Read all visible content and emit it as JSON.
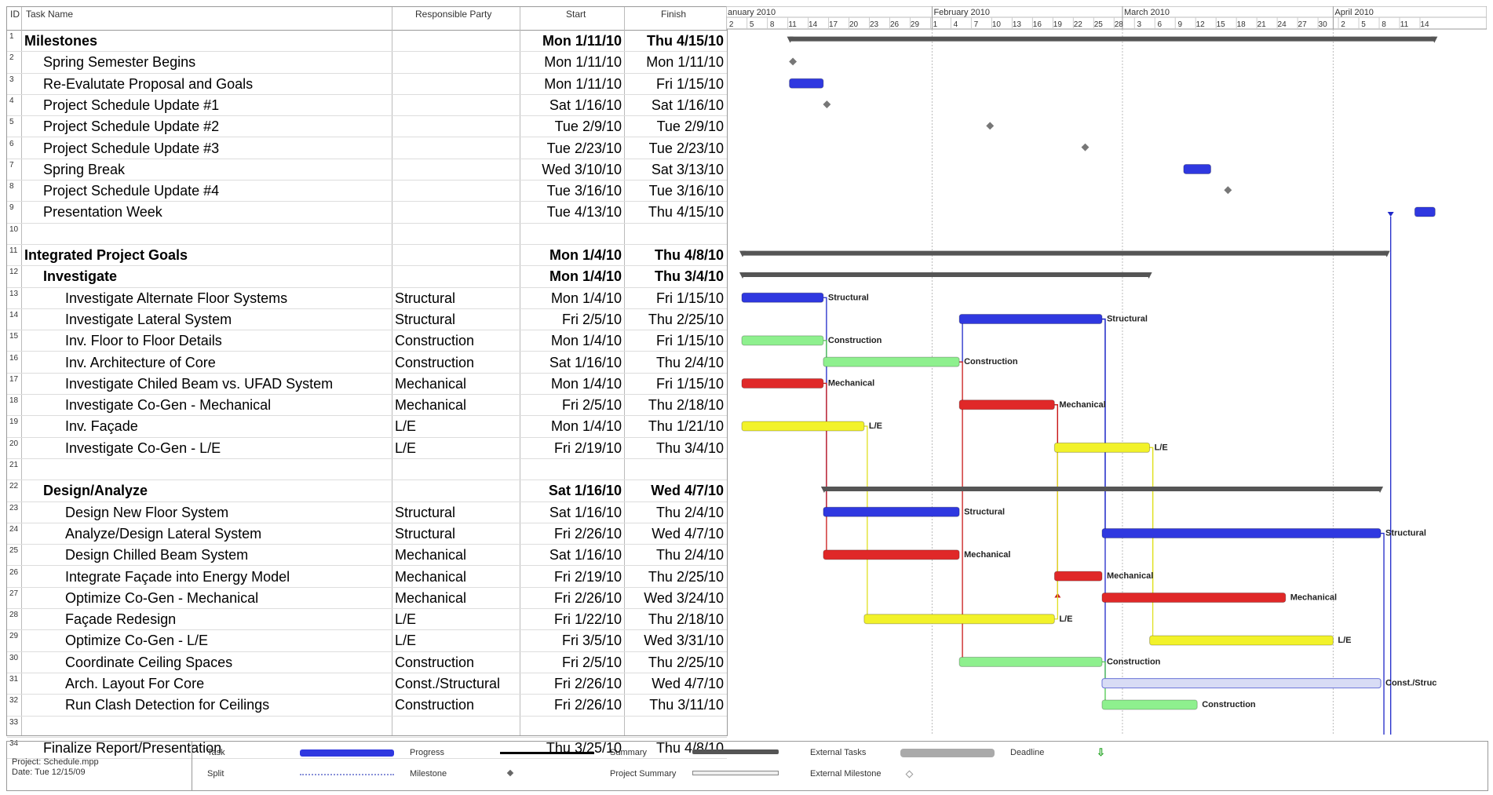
{
  "table": {
    "headers": {
      "id": "ID",
      "name": "Task Name",
      "party": "Responsible Party",
      "start": "Start",
      "finish": "Finish"
    },
    "rows": [
      {
        "id": "1",
        "name": "Milestones",
        "party": "",
        "start": "Mon 1/11/10",
        "finish": "Thu 4/15/10",
        "level": 0,
        "bold": true
      },
      {
        "id": "2",
        "name": "Spring Semester Begins",
        "party": "",
        "start": "Mon 1/11/10",
        "finish": "Mon 1/11/10",
        "level": 1,
        "bold": false
      },
      {
        "id": "3",
        "name": "Re-Evalutate Proposal and Goals",
        "party": "",
        "start": "Mon 1/11/10",
        "finish": "Fri 1/15/10",
        "level": 1,
        "bold": false
      },
      {
        "id": "4",
        "name": "Project Schedule Update #1",
        "party": "",
        "start": "Sat 1/16/10",
        "finish": "Sat 1/16/10",
        "level": 1,
        "bold": false
      },
      {
        "id": "5",
        "name": "Project Schedule Update #2",
        "party": "",
        "start": "Tue 2/9/10",
        "finish": "Tue 2/9/10",
        "level": 1,
        "bold": false
      },
      {
        "id": "6",
        "name": "Project Schedule Update #3",
        "party": "",
        "start": "Tue 2/23/10",
        "finish": "Tue 2/23/10",
        "level": 1,
        "bold": false
      },
      {
        "id": "7",
        "name": "Spring Break",
        "party": "",
        "start": "Wed 3/10/10",
        "finish": "Sat 3/13/10",
        "level": 1,
        "bold": false
      },
      {
        "id": "8",
        "name": "Project Schedule Update #4",
        "party": "",
        "start": "Tue 3/16/10",
        "finish": "Tue 3/16/10",
        "level": 1,
        "bold": false
      },
      {
        "id": "9",
        "name": "Presentation Week",
        "party": "",
        "start": "Tue 4/13/10",
        "finish": "Thu 4/15/10",
        "level": 1,
        "bold": false
      },
      {
        "id": "10",
        "name": "",
        "party": "",
        "start": "",
        "finish": "",
        "level": 0,
        "bold": false
      },
      {
        "id": "11",
        "name": "Integrated Project Goals",
        "party": "",
        "start": "Mon 1/4/10",
        "finish": "Thu 4/8/10",
        "level": 0,
        "bold": true
      },
      {
        "id": "12",
        "name": "Investigate",
        "party": "",
        "start": "Mon 1/4/10",
        "finish": "Thu 3/4/10",
        "level": 1,
        "bold": true
      },
      {
        "id": "13",
        "name": "Investigate Alternate Floor Systems",
        "party": "Structural",
        "start": "Mon 1/4/10",
        "finish": "Fri 1/15/10",
        "level": 2,
        "bold": false
      },
      {
        "id": "14",
        "name": "Investigate Lateral System",
        "party": "Structural",
        "start": "Fri 2/5/10",
        "finish": "Thu 2/25/10",
        "level": 2,
        "bold": false
      },
      {
        "id": "15",
        "name": "Inv. Floor to Floor Details",
        "party": "Construction",
        "start": "Mon 1/4/10",
        "finish": "Fri 1/15/10",
        "level": 2,
        "bold": false
      },
      {
        "id": "16",
        "name": "Inv. Architecture of Core",
        "party": "Construction",
        "start": "Sat 1/16/10",
        "finish": "Thu 2/4/10",
        "level": 2,
        "bold": false
      },
      {
        "id": "17",
        "name": "Investigate Chiled Beam vs. UFAD System",
        "party": "Mechanical",
        "start": "Mon 1/4/10",
        "finish": "Fri 1/15/10",
        "level": 2,
        "bold": false
      },
      {
        "id": "18",
        "name": "Investigate Co-Gen - Mechanical",
        "party": "Mechanical",
        "start": "Fri 2/5/10",
        "finish": "Thu 2/18/10",
        "level": 2,
        "bold": false
      },
      {
        "id": "19",
        "name": "Inv. Façade",
        "party": "L/E",
        "start": "Mon 1/4/10",
        "finish": "Thu 1/21/10",
        "level": 2,
        "bold": false
      },
      {
        "id": "20",
        "name": "Investigate Co-Gen - L/E",
        "party": "L/E",
        "start": "Fri 2/19/10",
        "finish": "Thu 3/4/10",
        "level": 2,
        "bold": false
      },
      {
        "id": "21",
        "name": "",
        "party": "",
        "start": "",
        "finish": "",
        "level": 0,
        "bold": false
      },
      {
        "id": "22",
        "name": "Design/Analyze",
        "party": "",
        "start": "Sat 1/16/10",
        "finish": "Wed 4/7/10",
        "level": 1,
        "bold": true
      },
      {
        "id": "23",
        "name": "Design New Floor System",
        "party": "Structural",
        "start": "Sat 1/16/10",
        "finish": "Thu 2/4/10",
        "level": 2,
        "bold": false
      },
      {
        "id": "24",
        "name": "Analyze/Design Lateral System",
        "party": "Structural",
        "start": "Fri 2/26/10",
        "finish": "Wed 4/7/10",
        "level": 2,
        "bold": false
      },
      {
        "id": "25",
        "name": "Design Chilled Beam System",
        "party": "Mechanical",
        "start": "Sat 1/16/10",
        "finish": "Thu 2/4/10",
        "level": 2,
        "bold": false
      },
      {
        "id": "26",
        "name": "Integrate Façade into Energy Model",
        "party": "Mechanical",
        "start": "Fri 2/19/10",
        "finish": "Thu 2/25/10",
        "level": 2,
        "bold": false
      },
      {
        "id": "27",
        "name": "Optimize Co-Gen - Mechanical",
        "party": "Mechanical",
        "start": "Fri 2/26/10",
        "finish": "Wed 3/24/10",
        "level": 2,
        "bold": false
      },
      {
        "id": "28",
        "name": "Façade Redesign",
        "party": "L/E",
        "start": "Fri 1/22/10",
        "finish": "Thu 2/18/10",
        "level": 2,
        "bold": false
      },
      {
        "id": "29",
        "name": "Optimize Co-Gen - L/E",
        "party": "L/E",
        "start": "Fri 3/5/10",
        "finish": "Wed 3/31/10",
        "level": 2,
        "bold": false
      },
      {
        "id": "30",
        "name": "Coordinate Ceiling Spaces",
        "party": "Construction",
        "start": "Fri 2/5/10",
        "finish": "Thu 2/25/10",
        "level": 2,
        "bold": false
      },
      {
        "id": "31",
        "name": "Arch. Layout For Core",
        "party": "Const./Structural",
        "start": "Fri 2/26/10",
        "finish": "Wed 4/7/10",
        "level": 2,
        "bold": false
      },
      {
        "id": "32",
        "name": "Run Clash Detection for Ceilings",
        "party": "Construction",
        "start": "Fri 2/26/10",
        "finish": "Thu 3/11/10",
        "level": 2,
        "bold": false
      },
      {
        "id": "33",
        "name": "",
        "party": "",
        "start": "",
        "finish": "",
        "level": 0,
        "bold": false
      },
      {
        "id": "34",
        "name": "Finalize Report/Presentation",
        "party": "",
        "start": "Thu 3/25/10",
        "finish": "Thu 4/8/10",
        "level": 1,
        "bold": false
      }
    ]
  },
  "timescale": {
    "months": [
      "anuary 2010",
      "February 2010",
      "March 2010",
      "April 2010"
    ],
    "days": [
      "2",
      "5",
      "8",
      "11",
      "14",
      "17",
      "20",
      "23",
      "26",
      "29",
      "1",
      "4",
      "7",
      "10",
      "13",
      "16",
      "19",
      "22",
      "25",
      "28",
      "3",
      "6",
      "9",
      "12",
      "15",
      "18",
      "21",
      "24",
      "27",
      "30",
      "2",
      "5",
      "8",
      "11",
      "14"
    ]
  },
  "legend": {
    "project": "Project: Schedule.mpp",
    "date": "Date: Tue 12/15/09",
    "task": "Task",
    "split": "Split",
    "progress": "Progress",
    "milestone": "Milestone",
    "summary": "Summary",
    "project_summary": "Project Summary",
    "external_tasks": "External Tasks",
    "external_milestone": "External Milestone",
    "deadline": "Deadline"
  },
  "colors": {
    "structural": "#2f38e0",
    "construction": "#8ef08e",
    "mechanical": "#e02828",
    "le": "#f2f22a",
    "summary": "#555555",
    "milestone": "#777777",
    "split_task": "#d8dcf5"
  },
  "chart_data": {
    "type": "gantt",
    "x_axis": "date",
    "xlim": [
      "2010-01-01",
      "2010-04-16"
    ],
    "bars": [
      {
        "row": "1",
        "kind": "summary",
        "start": "2010-01-11",
        "finish": "2010-04-15",
        "label": ""
      },
      {
        "row": "2",
        "kind": "milestone",
        "start": "2010-01-11",
        "finish": "2010-01-11",
        "label": ""
      },
      {
        "row": "3",
        "kind": "task",
        "color": "structural",
        "start": "2010-01-11",
        "finish": "2010-01-15",
        "label": ""
      },
      {
        "row": "4",
        "kind": "milestone",
        "start": "2010-01-16",
        "finish": "2010-01-16",
        "label": ""
      },
      {
        "row": "5",
        "kind": "milestone",
        "start": "2010-02-09",
        "finish": "2010-02-09",
        "label": ""
      },
      {
        "row": "6",
        "kind": "milestone",
        "start": "2010-02-23",
        "finish": "2010-02-23",
        "label": ""
      },
      {
        "row": "7",
        "kind": "task",
        "color": "structural",
        "start": "2010-03-10",
        "finish": "2010-03-13",
        "label": ""
      },
      {
        "row": "8",
        "kind": "milestone",
        "start": "2010-03-16",
        "finish": "2010-03-16",
        "label": ""
      },
      {
        "row": "9",
        "kind": "task",
        "color": "structural",
        "start": "2010-04-13",
        "finish": "2010-04-15",
        "label": ""
      },
      {
        "row": "11",
        "kind": "summary",
        "start": "2010-01-04",
        "finish": "2010-04-08",
        "label": ""
      },
      {
        "row": "12",
        "kind": "summary",
        "start": "2010-01-04",
        "finish": "2010-03-04",
        "label": ""
      },
      {
        "row": "13",
        "kind": "task",
        "color": "structural",
        "start": "2010-01-04",
        "finish": "2010-01-15",
        "label": "Structural"
      },
      {
        "row": "14",
        "kind": "task",
        "color": "structural",
        "start": "2010-02-05",
        "finish": "2010-02-25",
        "label": "Structural"
      },
      {
        "row": "15",
        "kind": "task",
        "color": "construction",
        "start": "2010-01-04",
        "finish": "2010-01-15",
        "label": "Construction"
      },
      {
        "row": "16",
        "kind": "task",
        "color": "construction",
        "start": "2010-01-16",
        "finish": "2010-02-04",
        "label": "Construction"
      },
      {
        "row": "17",
        "kind": "task",
        "color": "mechanical",
        "start": "2010-01-04",
        "finish": "2010-01-15",
        "label": "Mechanical"
      },
      {
        "row": "18",
        "kind": "task",
        "color": "mechanical",
        "start": "2010-02-05",
        "finish": "2010-02-18",
        "label": "Mechanical"
      },
      {
        "row": "19",
        "kind": "task",
        "color": "le",
        "start": "2010-01-04",
        "finish": "2010-01-21",
        "label": "L/E"
      },
      {
        "row": "20",
        "kind": "task",
        "color": "le",
        "start": "2010-02-19",
        "finish": "2010-03-04",
        "label": "L/E"
      },
      {
        "row": "22",
        "kind": "summary",
        "start": "2010-01-16",
        "finish": "2010-04-07",
        "label": ""
      },
      {
        "row": "23",
        "kind": "task",
        "color": "structural",
        "start": "2010-01-16",
        "finish": "2010-02-04",
        "label": "Structural"
      },
      {
        "row": "24",
        "kind": "task",
        "color": "structural",
        "start": "2010-02-26",
        "finish": "2010-04-07",
        "label": "Structural"
      },
      {
        "row": "25",
        "kind": "task",
        "color": "mechanical",
        "start": "2010-01-16",
        "finish": "2010-02-04",
        "label": "Mechanical"
      },
      {
        "row": "26",
        "kind": "task",
        "color": "mechanical",
        "start": "2010-02-19",
        "finish": "2010-02-25",
        "label": "Mechanical"
      },
      {
        "row": "27",
        "kind": "task",
        "color": "mechanical",
        "start": "2010-02-26",
        "finish": "2010-03-24",
        "label": "Mechanical"
      },
      {
        "row": "28",
        "kind": "task",
        "color": "le",
        "start": "2010-01-22",
        "finish": "2010-02-18",
        "label": "L/E"
      },
      {
        "row": "29",
        "kind": "task",
        "color": "le",
        "start": "2010-03-05",
        "finish": "2010-03-31",
        "label": "L/E"
      },
      {
        "row": "30",
        "kind": "task",
        "color": "construction",
        "start": "2010-02-05",
        "finish": "2010-02-25",
        "label": "Construction"
      },
      {
        "row": "31",
        "kind": "task",
        "color": "split_task",
        "start": "2010-02-26",
        "finish": "2010-04-07",
        "label": "Const./Struc"
      },
      {
        "row": "32",
        "kind": "task",
        "color": "construction",
        "start": "2010-02-26",
        "finish": "2010-03-11",
        "label": "Construction"
      },
      {
        "row": "34",
        "kind": "task",
        "color": "structural",
        "start": "2010-03-25",
        "finish": "2010-04-08",
        "label": ""
      }
    ],
    "dependencies": [
      {
        "from": "13",
        "to": "23",
        "color": "structural"
      },
      {
        "from": "14",
        "to": "24",
        "color": "structural"
      },
      {
        "from": "14",
        "to": "31",
        "color": "structural"
      },
      {
        "from": "15",
        "to": "16",
        "color": "construction"
      },
      {
        "from": "16",
        "to": "14",
        "color": "structural"
      },
      {
        "from": "17",
        "to": "25",
        "color": "mechanical"
      },
      {
        "from": "18",
        "to": "26",
        "color": "mechanical"
      },
      {
        "from": "18",
        "to": "27",
        "color": "mechanical"
      },
      {
        "from": "19",
        "to": "28",
        "color": "le"
      },
      {
        "from": "20",
        "to": "29",
        "color": "le"
      },
      {
        "from": "20",
        "to": "27",
        "color": "le"
      },
      {
        "from": "28",
        "to": "20",
        "color": "le"
      },
      {
        "from": "30",
        "to": "32",
        "color": "construction"
      },
      {
        "from": "16",
        "to": "30",
        "color": "mechanical"
      },
      {
        "from": "34",
        "to": "9",
        "color": "structural"
      },
      {
        "from": "24",
        "to": "34",
        "color": "structural"
      }
    ]
  }
}
